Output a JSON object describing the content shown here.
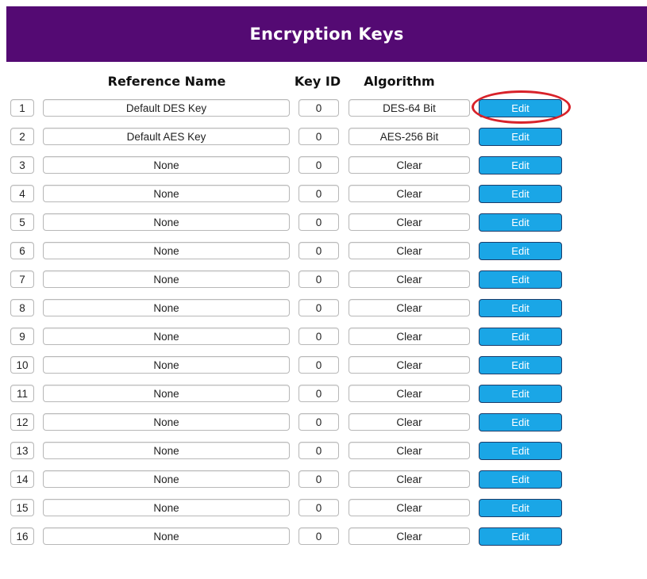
{
  "header": {
    "title": "Encryption Keys",
    "background": "#540a73"
  },
  "table": {
    "columns": {
      "reference_name": "Reference Name",
      "key_id": "Key ID",
      "algorithm": "Algorithm"
    },
    "edit_button_color": "#1aa6e6",
    "rows": [
      {
        "num": "1",
        "name": "Default DES Key",
        "key_id": "0",
        "algorithm": "DES-64 Bit",
        "action": "Edit"
      },
      {
        "num": "2",
        "name": "Default AES Key",
        "key_id": "0",
        "algorithm": "AES-256 Bit",
        "action": "Edit"
      },
      {
        "num": "3",
        "name": "None",
        "key_id": "0",
        "algorithm": "Clear",
        "action": "Edit"
      },
      {
        "num": "4",
        "name": "None",
        "key_id": "0",
        "algorithm": "Clear",
        "action": "Edit"
      },
      {
        "num": "5",
        "name": "None",
        "key_id": "0",
        "algorithm": "Clear",
        "action": "Edit"
      },
      {
        "num": "6",
        "name": "None",
        "key_id": "0",
        "algorithm": "Clear",
        "action": "Edit"
      },
      {
        "num": "7",
        "name": "None",
        "key_id": "0",
        "algorithm": "Clear",
        "action": "Edit"
      },
      {
        "num": "8",
        "name": "None",
        "key_id": "0",
        "algorithm": "Clear",
        "action": "Edit"
      },
      {
        "num": "9",
        "name": "None",
        "key_id": "0",
        "algorithm": "Clear",
        "action": "Edit"
      },
      {
        "num": "10",
        "name": "None",
        "key_id": "0",
        "algorithm": "Clear",
        "action": "Edit"
      },
      {
        "num": "11",
        "name": "None",
        "key_id": "0",
        "algorithm": "Clear",
        "action": "Edit"
      },
      {
        "num": "12",
        "name": "None",
        "key_id": "0",
        "algorithm": "Clear",
        "action": "Edit"
      },
      {
        "num": "13",
        "name": "None",
        "key_id": "0",
        "algorithm": "Clear",
        "action": "Edit"
      },
      {
        "num": "14",
        "name": "None",
        "key_id": "0",
        "algorithm": "Clear",
        "action": "Edit"
      },
      {
        "num": "15",
        "name": "None",
        "key_id": "0",
        "algorithm": "Clear",
        "action": "Edit"
      },
      {
        "num": "16",
        "name": "None",
        "key_id": "0",
        "algorithm": "Clear",
        "action": "Edit"
      }
    ]
  },
  "annotation": {
    "highlight_color": "#d8222a",
    "highlighted_row": "1"
  }
}
